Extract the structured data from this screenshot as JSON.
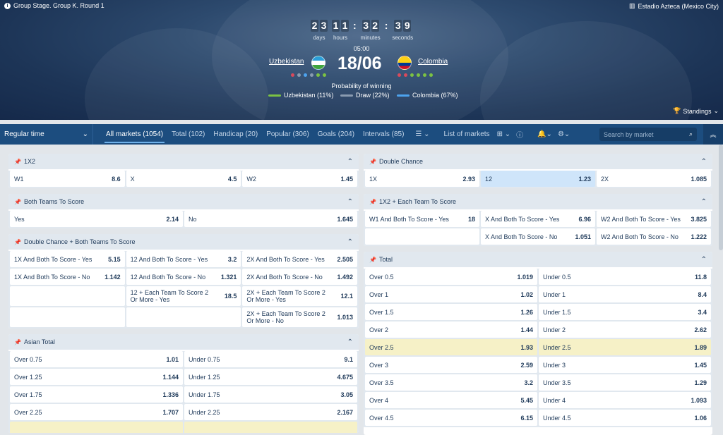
{
  "hero": {
    "stage": "Group Stage. Group K. Round 1",
    "venue": "Estadio Azteca (Mexico City)",
    "timer": {
      "days": [
        "2",
        "3"
      ],
      "hours": [
        "1",
        "1"
      ],
      "minutes": [
        "3",
        "2"
      ],
      "seconds": [
        "3",
        "9"
      ],
      "days_label": "days",
      "hours_label": "hours",
      "minutes_label": "minutes",
      "seconds_label": "seconds"
    },
    "time": "05:00",
    "team1": "Uzbekistan",
    "team2": "Colombia",
    "score": "18/06",
    "prob_title": "Probability of winning",
    "prob": [
      {
        "label": "Uzbekistan (11%)",
        "color": "#7cc243"
      },
      {
        "label": "Draw (22%)",
        "color": "#8a9bb0"
      },
      {
        "label": "Colombia (67%)",
        "color": "#4da3ee"
      }
    ],
    "standings": "Standings"
  },
  "nav": {
    "regular_time": "Regular time",
    "tabs": [
      "All markets (1054)",
      "Total (102)",
      "Handicap (20)",
      "Popular (306)",
      "Goals (204)",
      "Intervals (85)"
    ],
    "list_of_markets": "List of markets",
    "search_placeholder": "Search by market"
  },
  "markets": {
    "x12": {
      "title": "1X2",
      "rows": [
        [
          [
            "W1",
            "8.6"
          ],
          [
            "X",
            "4.5"
          ],
          [
            "W2",
            "1.45"
          ]
        ]
      ]
    },
    "btts": {
      "title": "Both Teams To Score",
      "rows": [
        [
          [
            "Yes",
            "2.14"
          ],
          [
            "No",
            "1.645"
          ]
        ]
      ]
    },
    "dcbtts": {
      "title": "Double Chance + Both Teams To Score",
      "rows": [
        [
          [
            "1X And Both To Score - Yes",
            "5.15"
          ],
          [
            "12 And Both To Score - Yes",
            "3.2"
          ],
          [
            "2X And Both To Score - Yes",
            "2.505"
          ]
        ],
        [
          [
            "1X And Both To Score - No",
            "1.142"
          ],
          [
            "12 And Both To Score - No",
            "1.321"
          ],
          [
            "2X And Both To Score - No",
            "1.492"
          ]
        ],
        [
          [
            "",
            ""
          ],
          [
            "12 + Each Team To Score 2 Or More - Yes",
            "18.5"
          ],
          [
            "2X + Each Team To Score 2 Or More - Yes",
            "12.1"
          ]
        ],
        [
          [
            "",
            ""
          ],
          [
            "",
            ""
          ],
          [
            "2X + Each Team To Score 2 Or More - No",
            "1.013"
          ]
        ]
      ]
    },
    "asian": {
      "title": "Asian Total",
      "rows": [
        [
          [
            "Over 0.75",
            "1.01"
          ],
          [
            "Under 0.75",
            "9.1"
          ]
        ],
        [
          [
            "Over 1.25",
            "1.144"
          ],
          [
            "Under 1.25",
            "4.675"
          ]
        ],
        [
          [
            "Over 1.75",
            "1.336"
          ],
          [
            "Under 1.75",
            "3.05"
          ]
        ],
        [
          [
            "Over 2.25",
            "1.707"
          ],
          [
            "Under 2.25",
            "2.167"
          ]
        ]
      ]
    },
    "dc": {
      "title": "Double Chance",
      "rows": [
        [
          [
            "1X",
            "2.93"
          ],
          [
            "12",
            "1.23"
          ],
          [
            "2X",
            "1.085"
          ]
        ]
      ]
    },
    "x12each": {
      "title": "1X2 + Each Team To Score",
      "rows": [
        [
          [
            "W1 And Both To Score - Yes",
            "18"
          ],
          [
            "X And Both To Score - Yes",
            "6.96"
          ],
          [
            "W2 And Both To Score - Yes",
            "3.825"
          ]
        ],
        [
          [
            "",
            ""
          ],
          [
            "X And Both To Score - No",
            "1.051"
          ],
          [
            "W2 And Both To Score - No",
            "1.222"
          ]
        ]
      ]
    },
    "total": {
      "title": "Total",
      "rows": [
        [
          [
            "Over 0.5",
            "1.019"
          ],
          [
            "Under 0.5",
            "11.8"
          ]
        ],
        [
          [
            "Over 1",
            "1.02"
          ],
          [
            "Under 1",
            "8.4"
          ]
        ],
        [
          [
            "Over 1.5",
            "1.26"
          ],
          [
            "Under 1.5",
            "3.4"
          ]
        ],
        [
          [
            "Over 2",
            "1.44"
          ],
          [
            "Under 2",
            "2.62"
          ]
        ],
        [
          [
            "Over 2.5",
            "1.93"
          ],
          [
            "Under 2.5",
            "1.89"
          ]
        ],
        [
          [
            "Over 3",
            "2.59"
          ],
          [
            "Under 3",
            "1.45"
          ]
        ],
        [
          [
            "Over 3.5",
            "3.2"
          ],
          [
            "Under 3.5",
            "1.29"
          ]
        ],
        [
          [
            "Over 4",
            "5.45"
          ],
          [
            "Under 4",
            "1.093"
          ]
        ],
        [
          [
            "Over 4.5",
            "6.15"
          ],
          [
            "Under 4.5",
            "1.06"
          ]
        ]
      ]
    }
  }
}
